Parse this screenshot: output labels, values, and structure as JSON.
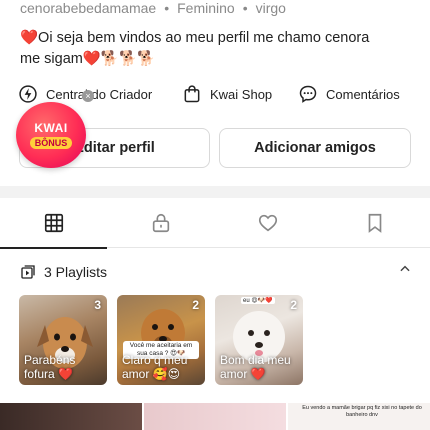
{
  "profile": {
    "username": "cenorabebedamamae",
    "gender": "Feminino",
    "sign": "virgo",
    "bio_line1": "❤️Oi seja bem vindos ao meu perfil me chamo cenora",
    "bio_line2": "me sigam❤️🐕🐕🐕"
  },
  "actions": {
    "creator_center": "Central do Criador",
    "kwai_shop": "Kwai Shop",
    "comments": "Comentários"
  },
  "buttons": {
    "edit_profile": "Editar perfil",
    "add_friends": "Adicionar amigos"
  },
  "badge": {
    "line1": "KWAI",
    "line2": "BÔNUS",
    "close": "×"
  },
  "tabs": [
    "grid",
    "lock",
    "heart",
    "bookmark"
  ],
  "playlists": {
    "header": "3 Playlists",
    "items": [
      {
        "title": "Parabéns fofura ❤️",
        "count": "3"
      },
      {
        "title": "Claro q meu amor 🥰😍",
        "count": "2",
        "overlay": "Você me aceitaria em sua casa ? 😍🐶"
      },
      {
        "title": "Bom dia meu amor ❤️",
        "count": "2",
        "overlay": "eu 😍🐶❤️"
      }
    ]
  },
  "bottom_strip": {
    "caption3": "Eu vendo a mamãe brigar pq fiz xixi no tapete do banheiro dnv"
  },
  "colors": {
    "accent": "#ff2d55",
    "text": "#222222",
    "muted": "#8a8a8a"
  }
}
